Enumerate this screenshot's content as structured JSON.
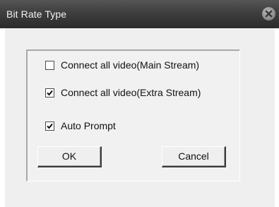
{
  "window": {
    "title": "Bit Rate Type",
    "close_icon": "close-icon"
  },
  "options": [
    {
      "label": "Connect all video(Main Stream)",
      "checked": false
    },
    {
      "label": "Connect all video(Extra Stream)",
      "checked": true
    },
    {
      "label": "Auto Prompt",
      "checked": true
    }
  ],
  "buttons": {
    "ok_label": "OK",
    "cancel_label": "Cancel"
  }
}
